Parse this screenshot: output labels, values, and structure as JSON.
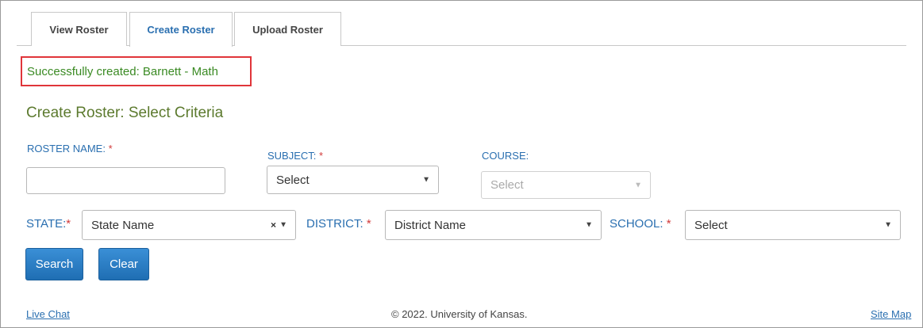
{
  "tabs": [
    {
      "label": "View Roster"
    },
    {
      "label": "Create Roster"
    },
    {
      "label": "Upload Roster"
    }
  ],
  "active_tab": "Create Roster",
  "success_message": "Successfully created: Barnett - Math",
  "section_title": "Create Roster: Select Criteria",
  "form": {
    "roster_name_label": "ROSTER NAME:",
    "roster_name_value": "",
    "subject_label": "SUBJECT:",
    "subject_value": "Select",
    "course_label": "COURSE:",
    "course_value": "Select",
    "state_label": "STATE:",
    "state_value": "State Name",
    "district_label": "DISTRICT:",
    "district_value": "District Name",
    "school_label": "SCHOOL:",
    "school_value": "Select",
    "required_marker": "*"
  },
  "buttons": {
    "search": "Search",
    "clear": "Clear"
  },
  "footer": {
    "live_chat": "Live Chat",
    "copyright": "© 2022. University of Kansas.",
    "site_map": "Site Map"
  },
  "colors": {
    "accent": "#2a6fb0",
    "success": "#3a8a23",
    "title": "#5c7a2e",
    "required": "#d23a3a",
    "highlight_border": "#e0353a"
  }
}
